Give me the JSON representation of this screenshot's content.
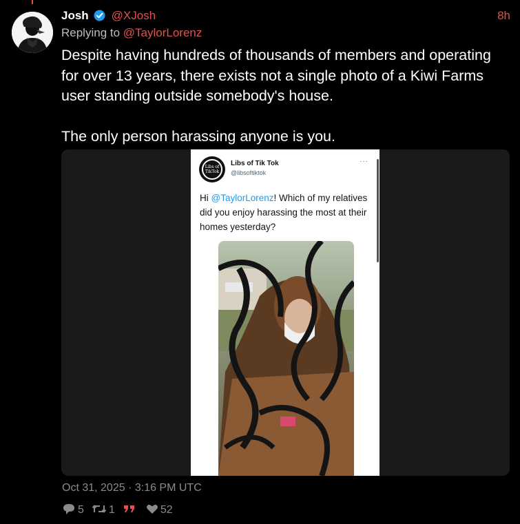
{
  "post": {
    "author_name": "Josh",
    "author_handle": "@XJosh",
    "time_ago": "8h",
    "reply_prefix": "Replying to",
    "reply_to": "@TaylorLorenz",
    "body_p1": "Despite having hundreds of thousands of members and operating for over 13 years, there exists not a single photo of a Kiwi Farms user standing outside somebody's house.",
    "body_p2": "The only person harassing anyone is you.",
    "timestamp": "Oct 31, 2025 · 3:16 PM UTC",
    "stats": {
      "replies": "5",
      "reposts": "1",
      "likes": "52"
    }
  },
  "embedded": {
    "name": "Libs of Tik Tok",
    "handle": "@libsoftiktok",
    "more": "···",
    "logo_text": "Libs of TikTok",
    "text_before": "Hi ",
    "mention": "@TaylorLorenz",
    "text_after": "! Which of my relatives did you enjoy harassing the most at their homes yesterday?"
  },
  "colors": {
    "accent": "#e0524d",
    "verified": "#1d9bf0",
    "muted": "#8b8b8b"
  },
  "icons": [
    "verified-badge-icon",
    "reply-icon",
    "repost-icon",
    "quote-icon",
    "heart-icon"
  ]
}
